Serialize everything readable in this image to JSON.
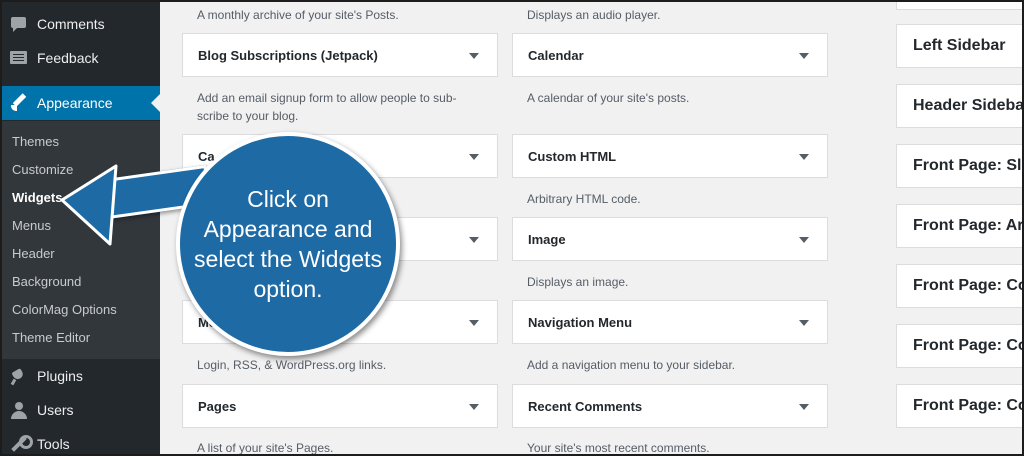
{
  "sidebar": {
    "top_items": [
      {
        "label": "Comments",
        "icon": "comment-icon"
      },
      {
        "label": "Feedback",
        "icon": "feedback-icon"
      }
    ],
    "active_item": {
      "label": "Appearance",
      "icon": "paintbrush-icon"
    },
    "submenu": [
      "Themes",
      "Customize",
      "Widgets",
      "Menus",
      "Header",
      "Background",
      "ColorMag Options",
      "Theme Editor"
    ],
    "current_submenu": "Widgets",
    "bottom_items": [
      {
        "label": "Plugins",
        "icon": "plugin-icon"
      },
      {
        "label": "Users",
        "icon": "users-icon"
      },
      {
        "label": "Tools",
        "icon": "tools-icon"
      }
    ]
  },
  "widgets": {
    "top_descriptions": [
      "A monthly archive of your site's Posts.",
      "Displays an audio player."
    ],
    "left": [
      {
        "title": "Blog Subscriptions (Jetpack)",
        "description": "Add an email signup form to allow people to sub-scribe to your blog."
      },
      {
        "title": "Ca",
        "description": ""
      },
      {
        "title": "",
        "description": ""
      },
      {
        "title": "Meta",
        "description": "Login, RSS, & WordPress.org links."
      },
      {
        "title": "Pages",
        "description": "A list of your site's Pages."
      }
    ],
    "right": [
      {
        "title": "Calendar",
        "description": "A calendar of your site's posts."
      },
      {
        "title": "Custom HTML",
        "description": "Arbitrary HTML code."
      },
      {
        "title": "Image",
        "description": "Displays an image."
      },
      {
        "title": "Navigation Menu",
        "description": "Add a navigation menu to your sidebar."
      },
      {
        "title": "Recent Comments",
        "description": "Your site's most recent comments."
      }
    ]
  },
  "widget_areas": [
    "Left Sidebar",
    "Header Sideba",
    "Front Page: Sli",
    "Front Page: Ar",
    "Front Page: Co",
    "Front Page: Co",
    "Front Page: Co"
  ],
  "callout": {
    "text": "Click on Appearance and select the Widgets option."
  },
  "colors": {
    "admin_bar": "#23282d",
    "active": "#0073aa",
    "callout": "#1d6aa5"
  }
}
